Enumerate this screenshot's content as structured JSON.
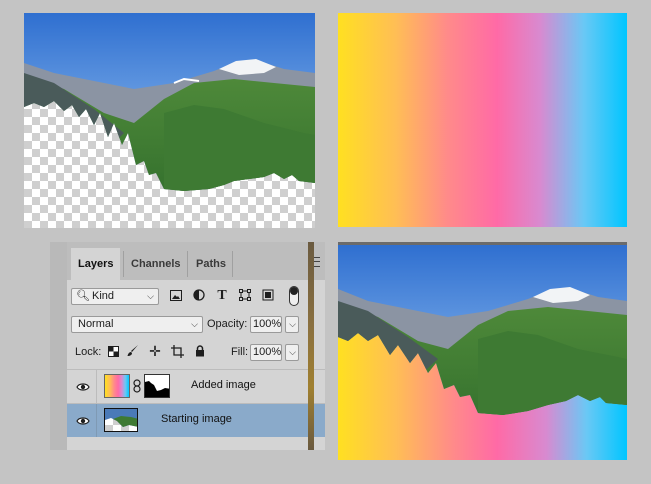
{
  "panel": {
    "tabs": [
      {
        "label": "Layers",
        "active": true
      },
      {
        "label": "Channels",
        "active": false
      },
      {
        "label": "Paths",
        "active": false
      }
    ]
  },
  "filter": {
    "kind_label": "Kind"
  },
  "blend": {
    "mode": "Normal",
    "opacity_label": "Opacity:",
    "opacity_value": "100%"
  },
  "lock": {
    "label": "Lock:",
    "fill_label": "Fill:",
    "fill_value": "100%"
  },
  "layers": [
    {
      "name": "Added image",
      "visible": true,
      "selected": false
    },
    {
      "name": "Starting image",
      "visible": true,
      "selected": true
    }
  ],
  "colors": {
    "selected_row": "#8aaaca",
    "panel_bg": "#d4d4d4",
    "gradient": [
      "#ffe021",
      "#ff6aa6",
      "#00c6ff"
    ]
  },
  "icons": [
    "search-icon",
    "image-filter-icon",
    "adjustment-filter-icon",
    "type-filter-icon",
    "shape-filter-icon",
    "smart-object-filter-icon",
    "filter-toggle-icon",
    "lock-pixels-icon",
    "brush-icon",
    "move-icon",
    "artboard-icon",
    "padlock-icon",
    "eye-icon",
    "link-icon",
    "panel-menu-icon"
  ]
}
